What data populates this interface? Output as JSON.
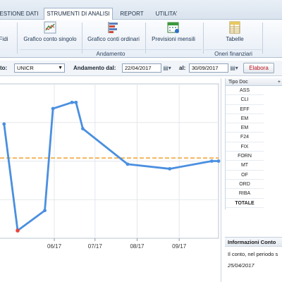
{
  "menu": {
    "tabs": [
      {
        "label": "ESTIONE DATI"
      },
      {
        "label": "STRUMENTI DI ANALISI"
      },
      {
        "label": "REPORT"
      },
      {
        "label": "UTILITA'"
      }
    ]
  },
  "ribbon": {
    "buttons": [
      {
        "label": "Fidi"
      },
      {
        "label": "Grafico conto singolo"
      },
      {
        "label": "Grafico conti ordinari"
      },
      {
        "label": "Previsioni mensili"
      },
      {
        "label": "Tabelle"
      }
    ],
    "groups": {
      "andamento": "Andamento",
      "oneri": "Oneri finanziari"
    }
  },
  "filters": {
    "conto_label": "to:",
    "conto_value": "UNICR",
    "from_label": "Andamento dal:",
    "from_value": "22/04/2017",
    "to_label": "al:",
    "to_value": "30/09/2017",
    "elabora_label": "Elabora"
  },
  "chart_data": {
    "type": "line",
    "x_tick_labels": [
      "06/17",
      "07/17",
      "08/17",
      "09/17"
    ],
    "series": [
      {
        "color": "#4a8fe0",
        "points": [
          {
            "x": "2017-04-25",
            "y": 0.74
          },
          {
            "x": "2017-05-05",
            "y": 0.05
          },
          {
            "x": "2017-05-25",
            "y": 0.18
          },
          {
            "x": "2017-05-31",
            "y": 0.84
          },
          {
            "x": "2017-06-14",
            "y": 0.88
          },
          {
            "x": "2017-06-17",
            "y": 0.88
          },
          {
            "x": "2017-06-22",
            "y": 0.71
          },
          {
            "x": "2017-07-25",
            "y": 0.48
          },
          {
            "x": "2017-08-25",
            "y": 0.45
          },
          {
            "x": "2017-09-25",
            "y": 0.5
          },
          {
            "x": "2017-09-30",
            "y": 0.5
          }
        ]
      }
    ],
    "reference_line": {
      "y": 0.52,
      "color": "#f0a030",
      "style": "dashed"
    },
    "min_marker_color": "#e8453c",
    "grid": true
  },
  "table": {
    "header": "Tipo Doc",
    "header_extra": "+",
    "rows": [
      "ASS",
      "CLI",
      "EFF",
      "EM",
      "EM",
      "F24",
      "FIX",
      "FORN",
      "MT",
      "OF",
      "ORD",
      "RIBA",
      "TOTALE"
    ]
  },
  "info": {
    "title": "Informazioni Conto",
    "text": "Il conto, nel periodo s",
    "date": "25/04/2017"
  },
  "colors": {
    "accent": "#4a8fe0",
    "reference": "#f0a030",
    "elabora_text": "#c0141c"
  }
}
